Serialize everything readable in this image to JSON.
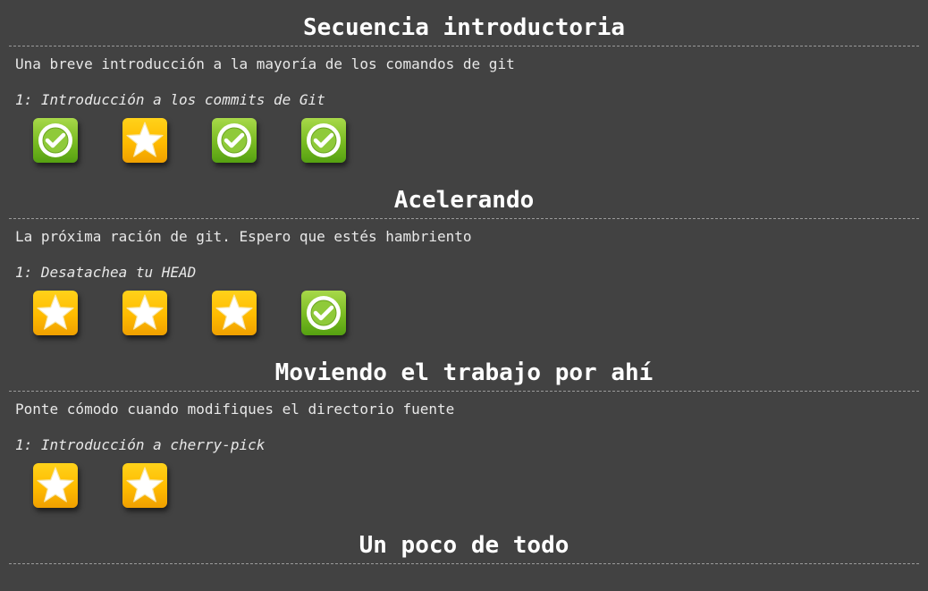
{
  "colors": {
    "background": "#424242",
    "solved": "#79bb22",
    "unsolved": "#ffbb00",
    "text": "#f2f2f2"
  },
  "sequences": [
    {
      "title": "Secuencia introductoria",
      "about": "Una breve introducción a la mayoría de los comandos de git",
      "level_hint": "1: Introducción a los commits de Git",
      "levels": [
        {
          "status": "solved",
          "icon": "check-icon"
        },
        {
          "status": "unsolved",
          "icon": "star-icon"
        },
        {
          "status": "solved",
          "icon": "check-icon"
        },
        {
          "status": "solved",
          "icon": "check-icon"
        }
      ]
    },
    {
      "title": "Acelerando",
      "about": "La próxima ración de git. Espero que estés hambriento",
      "level_hint": "1: Desatachea tu HEAD",
      "levels": [
        {
          "status": "unsolved",
          "icon": "star-icon"
        },
        {
          "status": "unsolved",
          "icon": "star-icon"
        },
        {
          "status": "unsolved",
          "icon": "star-icon"
        },
        {
          "status": "solved",
          "icon": "check-icon"
        }
      ]
    },
    {
      "title": "Moviendo el trabajo por ahí",
      "about": "Ponte cómodo cuando modifiques el directorio fuente",
      "level_hint": "1: Introducción a cherry-pick",
      "levels": [
        {
          "status": "unsolved",
          "icon": "star-icon"
        },
        {
          "status": "unsolved",
          "icon": "star-icon"
        }
      ]
    },
    {
      "title": "Un poco de todo"
    }
  ]
}
